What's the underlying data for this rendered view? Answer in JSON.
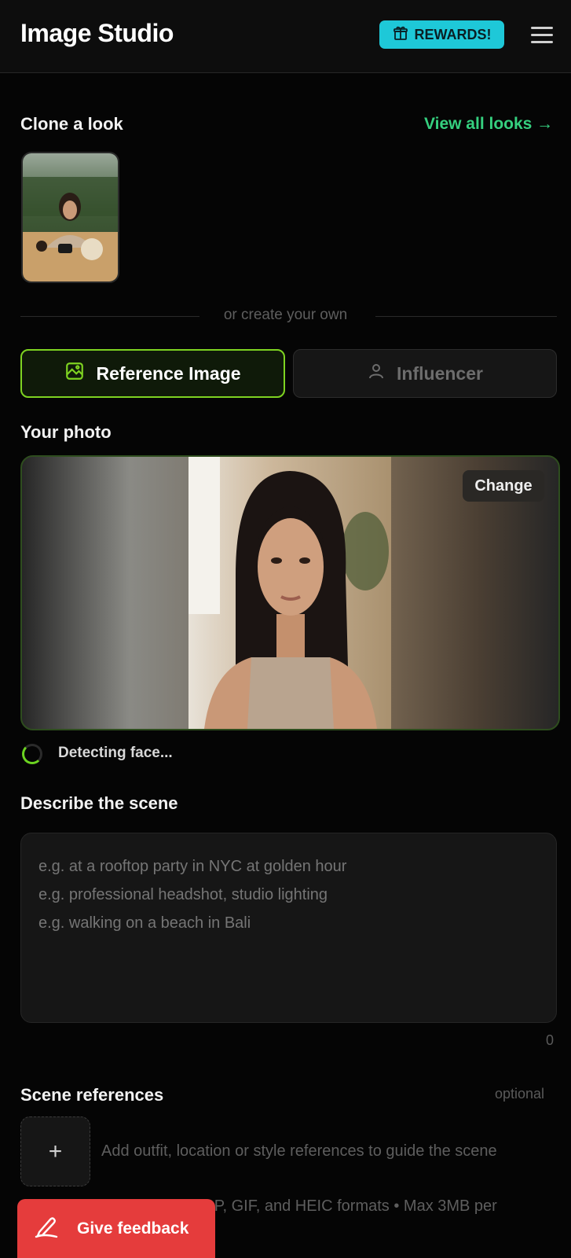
{
  "header": {
    "title": "Image Studio",
    "rewards_label": "REWARDS!",
    "rewards_icon": "gift-icon",
    "menu_icon": "hamburger-menu-icon"
  },
  "clone_section": {
    "title": "Clone a look",
    "view_all_label": "View all looks →"
  },
  "divider_text": "or create your own",
  "tabs": [
    {
      "label": "Reference Image",
      "icon": "image-icon",
      "selected": true
    },
    {
      "label": "Influencer",
      "icon": "person-icon",
      "selected": false
    }
  ],
  "photo_section": {
    "title": "Your photo",
    "change_label": "Change",
    "status_text": "Detecting face..."
  },
  "scene_section": {
    "title": "Describe the scene",
    "placeholder": "e.g. at a rooftop party in NYC at golden hour\ne.g. professional headshot, studio lighting\ne.g. walking on a beach in Bali",
    "value": "",
    "char_count": "0"
  },
  "references_section": {
    "title": "Scene references",
    "optional_label": "optional",
    "add_label": "+",
    "hint": "Add outfit, location or style references to guide the scene",
    "formats_partial": "pP, GIF, and HEIC formats • Max 3MB per"
  },
  "feedback": {
    "label": "Give feedback",
    "icon": "pen-icon"
  },
  "colors": {
    "accent_green": "#7ed321",
    "link_green": "#35d07f",
    "rewards_cyan": "#1ec8d8",
    "feedback_red": "#e53c3c"
  }
}
